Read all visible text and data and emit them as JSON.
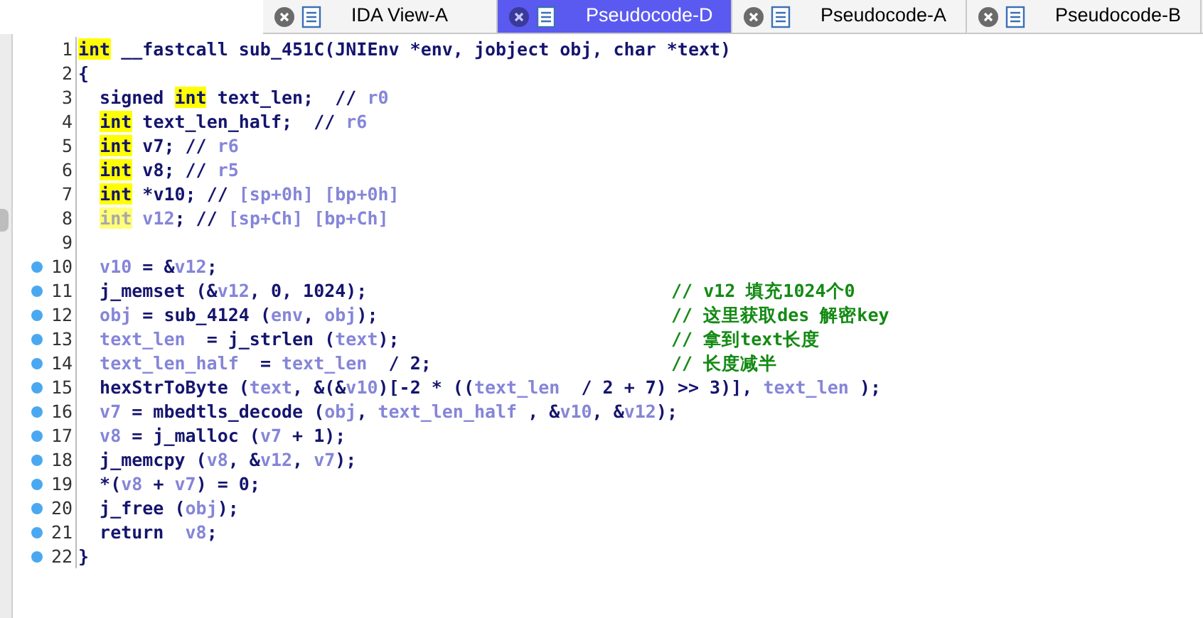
{
  "tabs": [
    {
      "label": "IDA View-A",
      "selected": false
    },
    {
      "label": "Pseudocode-D",
      "selected": true
    },
    {
      "label": "Pseudocode-A",
      "selected": false
    },
    {
      "label": "Pseudocode-B",
      "selected": false
    }
  ],
  "lines": [
    {
      "number": "1",
      "dot": false,
      "tokens": [
        {
          "kind": "hl",
          "text": "int"
        },
        {
          "kind": "kw",
          "text": " __fastcall sub_451C(JNIEnv *env, jobject obj, char *text)"
        }
      ]
    },
    {
      "number": "2",
      "dot": false,
      "tokens": [
        {
          "kind": "kw",
          "text": "{"
        }
      ]
    },
    {
      "number": "3",
      "dot": false,
      "tokens": [
        {
          "kind": "kw",
          "text": "  signed "
        },
        {
          "kind": "hl",
          "text": "int"
        },
        {
          "kind": "kw",
          "text": " text_len;  // "
        },
        {
          "kind": "var",
          "text": "r0"
        }
      ]
    },
    {
      "number": "4",
      "dot": false,
      "tokens": [
        {
          "kind": "indent"
        },
        {
          "kind": "hl",
          "text": "int"
        },
        {
          "kind": "kw",
          "text": " text_len_half;  // "
        },
        {
          "kind": "var",
          "text": "r6"
        }
      ]
    },
    {
      "number": "5",
      "dot": false,
      "tokens": [
        {
          "kind": "indent"
        },
        {
          "kind": "hl",
          "text": "int"
        },
        {
          "kind": "kw",
          "text": " v7; // "
        },
        {
          "kind": "var",
          "text": "r6"
        }
      ]
    },
    {
      "number": "6",
      "dot": false,
      "tokens": [
        {
          "kind": "indent"
        },
        {
          "kind": "hl",
          "text": "int"
        },
        {
          "kind": "kw",
          "text": " v8; // "
        },
        {
          "kind": "var",
          "text": "r5"
        }
      ]
    },
    {
      "number": "7",
      "dot": false,
      "tokens": [
        {
          "kind": "indent"
        },
        {
          "kind": "hl",
          "text": "int"
        },
        {
          "kind": "kw",
          "text": " *v10; // "
        },
        {
          "kind": "var",
          "text": "[sp+0h] [bp+0h]"
        }
      ]
    },
    {
      "number": "8",
      "dot": false,
      "tokens": [
        {
          "kind": "indent"
        },
        {
          "kind": "hl_dim",
          "text": "int"
        },
        {
          "kind": "var",
          "text": " v12"
        },
        {
          "kind": "kw",
          "text": "; // "
        },
        {
          "kind": "var",
          "text": "[sp+Ch] [bp+Ch]"
        }
      ]
    },
    {
      "number": "9",
      "dot": false
    },
    {
      "number": "10",
      "dot": true,
      "tokens": [
        {
          "kind": "var",
          "text": "  v10"
        },
        {
          "kind": "kw",
          "text": " = &"
        },
        {
          "kind": "var",
          "text": "v12"
        },
        {
          "kind": "kw",
          "text": ";"
        }
      ]
    },
    {
      "number": "11",
      "dot": true,
      "comment": "// v12 填充1024个0",
      "tokens": [
        {
          "kind": "kw",
          "text": "  j_memset (&"
        },
        {
          "kind": "var",
          "text": "v12"
        },
        {
          "kind": "kw",
          "text": ", 0, 1024);"
        }
      ]
    },
    {
      "number": "12",
      "dot": true,
      "comment": "// 这里获取des 解密key",
      "tokens": [
        {
          "kind": "var",
          "text": "  obj"
        },
        {
          "kind": "kw",
          "text": " = sub_4124 ("
        },
        {
          "kind": "var",
          "text": "env"
        },
        {
          "kind": "kw",
          "text": ", "
        },
        {
          "kind": "var",
          "text": "obj"
        },
        {
          "kind": "kw",
          "text": ");"
        }
      ]
    },
    {
      "number": "13",
      "dot": true,
      "comment": "// 拿到text长度",
      "tokens": [
        {
          "kind": "var",
          "text": "  text_len"
        },
        {
          "kind": "kw",
          "text": "  = j_strlen ("
        },
        {
          "kind": "var",
          "text": "text"
        },
        {
          "kind": "kw",
          "text": ");"
        }
      ]
    },
    {
      "number": "14",
      "dot": true,
      "comment": "// 长度减半",
      "tokens": [
        {
          "kind": "var",
          "text": "  text_len_half"
        },
        {
          "kind": "kw",
          "text": "  = "
        },
        {
          "kind": "var",
          "text": "text_len"
        },
        {
          "kind": "kw",
          "text": "  / 2;"
        }
      ]
    },
    {
      "number": "15",
      "dot": true,
      "tokens": [
        {
          "kind": "kw",
          "text": "  hexStrToByte ("
        },
        {
          "kind": "var",
          "text": "text"
        },
        {
          "kind": "kw",
          "text": ", &(&"
        },
        {
          "kind": "var",
          "text": "v10"
        },
        {
          "kind": "kw",
          "text": ")[-2 * (("
        },
        {
          "kind": "var",
          "text": "text_len"
        },
        {
          "kind": "kw",
          "text": "  / 2 + 7) >> 3)], "
        },
        {
          "kind": "var",
          "text": "text_len"
        },
        {
          "kind": "kw",
          "text": " );"
        }
      ]
    },
    {
      "number": "16",
      "dot": true,
      "tokens": [
        {
          "kind": "var",
          "text": "  v7"
        },
        {
          "kind": "kw",
          "text": " = mbedtls_decode ("
        },
        {
          "kind": "var",
          "text": "obj"
        },
        {
          "kind": "kw",
          "text": ", "
        },
        {
          "kind": "var",
          "text": "text_len_half"
        },
        {
          "kind": "kw",
          "text": " , &"
        },
        {
          "kind": "var",
          "text": "v10"
        },
        {
          "kind": "kw",
          "text": ", &"
        },
        {
          "kind": "var",
          "text": "v12"
        },
        {
          "kind": "kw",
          "text": ");"
        }
      ]
    },
    {
      "number": "17",
      "dot": true,
      "tokens": [
        {
          "kind": "var",
          "text": "  v8"
        },
        {
          "kind": "kw",
          "text": " = j_malloc ("
        },
        {
          "kind": "var",
          "text": "v7"
        },
        {
          "kind": "kw",
          "text": " + 1);"
        }
      ]
    },
    {
      "number": "18",
      "dot": true,
      "tokens": [
        {
          "kind": "kw",
          "text": "  j_memcpy ("
        },
        {
          "kind": "var",
          "text": "v8"
        },
        {
          "kind": "kw",
          "text": ", &"
        },
        {
          "kind": "var",
          "text": "v12"
        },
        {
          "kind": "kw",
          "text": ", "
        },
        {
          "kind": "var",
          "text": "v7"
        },
        {
          "kind": "kw",
          "text": ");"
        }
      ]
    },
    {
      "number": "19",
      "dot": true,
      "tokens": [
        {
          "kind": "kw",
          "text": "  *("
        },
        {
          "kind": "var",
          "text": "v8"
        },
        {
          "kind": "kw",
          "text": " + "
        },
        {
          "kind": "var",
          "text": "v7"
        },
        {
          "kind": "kw",
          "text": ") = 0;"
        }
      ]
    },
    {
      "number": "20",
      "dot": true,
      "tokens": [
        {
          "kind": "kw",
          "text": "  j_free ("
        },
        {
          "kind": "var",
          "text": "obj"
        },
        {
          "kind": "kw",
          "text": ");"
        }
      ]
    },
    {
      "number": "21",
      "dot": true,
      "tokens": [
        {
          "kind": "kw",
          "text": "  return  "
        },
        {
          "kind": "var",
          "text": "v8"
        },
        {
          "kind": "kw",
          "text": ";"
        }
      ]
    },
    {
      "number": "22",
      "dot": true,
      "tokens": [
        {
          "kind": "kw",
          "text": "}"
        }
      ]
    }
  ]
}
